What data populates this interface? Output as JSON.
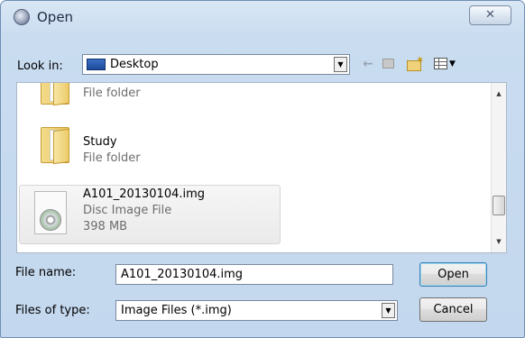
{
  "window": {
    "title": "Open",
    "close_glyph": "✕"
  },
  "toolbar": {
    "look_in_label": "Look in:",
    "look_in_value": "Desktop",
    "back_glyph": "←",
    "dropdown_glyph": "▼"
  },
  "file_list": {
    "items": [
      {
        "name": "",
        "type": "File folder",
        "icon": "folder-icon"
      },
      {
        "name": "Study",
        "type": "File folder",
        "icon": "folder-icon"
      },
      {
        "name": "A101_20130104.img",
        "type": "Disc Image File",
        "size": "398 MB",
        "icon": "disc-image-icon",
        "selected": true
      }
    ]
  },
  "scrollbar": {
    "up_glyph": "▲",
    "down_glyph": "▼"
  },
  "file_name": {
    "label": "File name:",
    "value": "A101_20130104.img"
  },
  "file_type": {
    "label": "Files of type:",
    "value": "Image Files (*.img)"
  },
  "buttons": {
    "open": "Open",
    "cancel": "Cancel"
  },
  "colors": {
    "frame": "#c9dcf0",
    "selection": "#eaeaea"
  }
}
